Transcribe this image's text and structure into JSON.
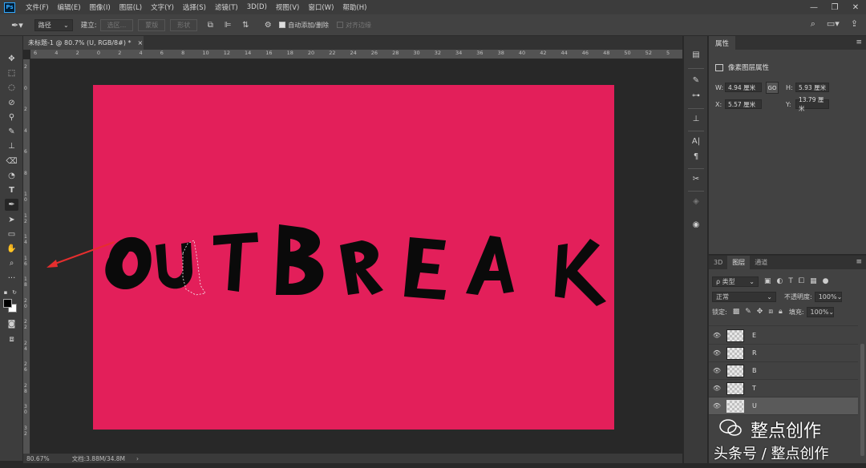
{
  "app": {
    "logo": "Ps",
    "menu": [
      "文件(F)",
      "编辑(E)",
      "图像(I)",
      "图层(L)",
      "文字(Y)",
      "选择(S)",
      "滤镜(T)",
      "3D(D)",
      "视图(V)",
      "窗口(W)",
      "帮助(H)"
    ]
  },
  "options_bar": {
    "mode_select": "路径",
    "make_label": "建立:",
    "selection_btn": "选区...",
    "mask_btn": "蒙版",
    "shape_btn": "形状",
    "auto_add_delete": "自动添加/删除",
    "align_edges": "对齐边缘"
  },
  "document": {
    "tab_title": "未标题-1 @ 80.7% (U, RGB/8#) *",
    "zoom": "80.67%",
    "doc_info": "文档:3.88M/34.8M",
    "canvas_color": "#e31f5a",
    "canvas_text": "OUTBREAK",
    "ruler_top": [
      "6",
      "4",
      "2",
      "0",
      "2",
      "4",
      "6",
      "8",
      "10",
      "12",
      "14",
      "16",
      "18",
      "20",
      "22",
      "24",
      "26",
      "28",
      "30",
      "32",
      "34",
      "36",
      "38",
      "40",
      "42",
      "44",
      "46",
      "48",
      "50",
      "52",
      "5"
    ],
    "ruler_left": [
      "2",
      "0",
      "2",
      "4",
      "6",
      "8",
      "1 0",
      "1 2",
      "1 4",
      "1 6",
      "1 8",
      "2 0",
      "2 2",
      "2 4",
      "2 6",
      "2 8",
      "3 0",
      "3 2"
    ]
  },
  "properties": {
    "tab": "属性",
    "subtitle": "像素图层属性",
    "w_label": "W:",
    "w_value": "4.94 厘米",
    "h_label": "H:",
    "h_value": "5.93 厘米",
    "x_label": "X:",
    "x_value": "5.57 厘米",
    "y_label": "Y:",
    "y_value": "13.79 厘米",
    "link_icon": "GO"
  },
  "layers_panel": {
    "tabs": [
      "3D",
      "图层",
      "通道"
    ],
    "filter_select": "ρ 类型",
    "blend_mode": "正常",
    "opacity_label": "不透明度:",
    "opacity_value": "100%",
    "lock_label": "锁定:",
    "fill_label": "填充:",
    "fill_value": "100%",
    "layers": [
      {
        "name": "E",
        "selected": false
      },
      {
        "name": "R",
        "selected": false
      },
      {
        "name": "B",
        "selected": false
      },
      {
        "name": "T",
        "selected": false
      },
      {
        "name": "U",
        "selected": true
      }
    ]
  },
  "watermark": {
    "name": "整点创作",
    "sub": "头条号 / 整点创作"
  }
}
